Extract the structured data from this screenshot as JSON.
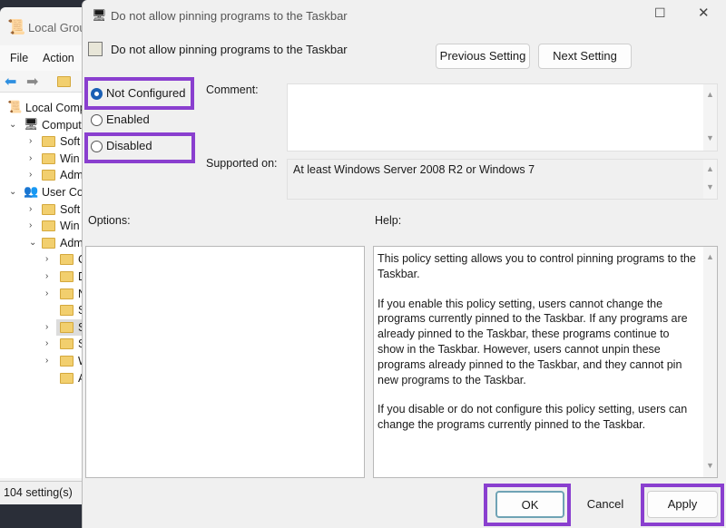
{
  "left_window": {
    "title": "Local Grou",
    "menu": [
      "File",
      "Action"
    ],
    "status": "104 setting(s)",
    "tree": [
      {
        "label": "Local Comp",
        "indent": 0,
        "chev": "",
        "icon": "policy"
      },
      {
        "label": "Comput",
        "indent": 1,
        "chev": "v",
        "icon": "computer"
      },
      {
        "label": "Soft",
        "indent": 2,
        "chev": ">",
        "icon": "folder"
      },
      {
        "label": "Win",
        "indent": 2,
        "chev": ">",
        "icon": "folder"
      },
      {
        "label": "Adm",
        "indent": 2,
        "chev": ">",
        "icon": "folder"
      },
      {
        "label": "User Co",
        "indent": 1,
        "chev": "v",
        "icon": "user"
      },
      {
        "label": "Soft",
        "indent": 2,
        "chev": ">",
        "icon": "folder"
      },
      {
        "label": "Win",
        "indent": 2,
        "chev": ">",
        "icon": "folder"
      },
      {
        "label": "Adm",
        "indent": 2,
        "chev": "v",
        "icon": "folder"
      },
      {
        "label": "C",
        "indent": 3,
        "chev": ">",
        "icon": "folder"
      },
      {
        "label": "D",
        "indent": 3,
        "chev": ">",
        "icon": "folder"
      },
      {
        "label": "N",
        "indent": 3,
        "chev": ">",
        "icon": "folder"
      },
      {
        "label": "S",
        "indent": 3,
        "chev": "",
        "icon": "folder"
      },
      {
        "label": "S",
        "indent": 3,
        "chev": ">",
        "icon": "folder",
        "selected": true
      },
      {
        "label": "S",
        "indent": 3,
        "chev": ">",
        "icon": "folder"
      },
      {
        "label": "W",
        "indent": 3,
        "chev": ">",
        "icon": "folder"
      },
      {
        "label": "A",
        "indent": 3,
        "chev": "",
        "icon": "settings-folder"
      }
    ]
  },
  "dialog": {
    "title": "Do not allow pinning programs to the Taskbar",
    "header": "Do not allow pinning programs to the Taskbar",
    "prev_label": "Previous Setting",
    "next_label": "Next Setting",
    "radios": {
      "not_configured": "Not Configured",
      "enabled": "Enabled",
      "disabled": "Disabled",
      "selected": "not_configured"
    },
    "comment_label": "Comment:",
    "comment_value": "",
    "supported_label": "Supported on:",
    "supported_value": "At least Windows Server 2008 R2 or Windows 7",
    "options_label": "Options:",
    "help_label": "Help:",
    "help": [
      "This policy setting allows you to control pinning programs to the Taskbar.",
      "If you enable this policy setting, users cannot change the programs currently pinned to the Taskbar. If any programs are already pinned to the Taskbar, these programs continue to show in the Taskbar. However, users cannot unpin these programs already pinned to the Taskbar, and they cannot pin new programs to the Taskbar.",
      "If you disable or do not configure this policy setting, users can change the programs currently pinned to the Taskbar."
    ],
    "ok": "OK",
    "cancel": "Cancel",
    "apply": "Apply"
  },
  "colors": {
    "highlight": "#8a3fcf",
    "radio_selected": "#1a5fb4"
  }
}
